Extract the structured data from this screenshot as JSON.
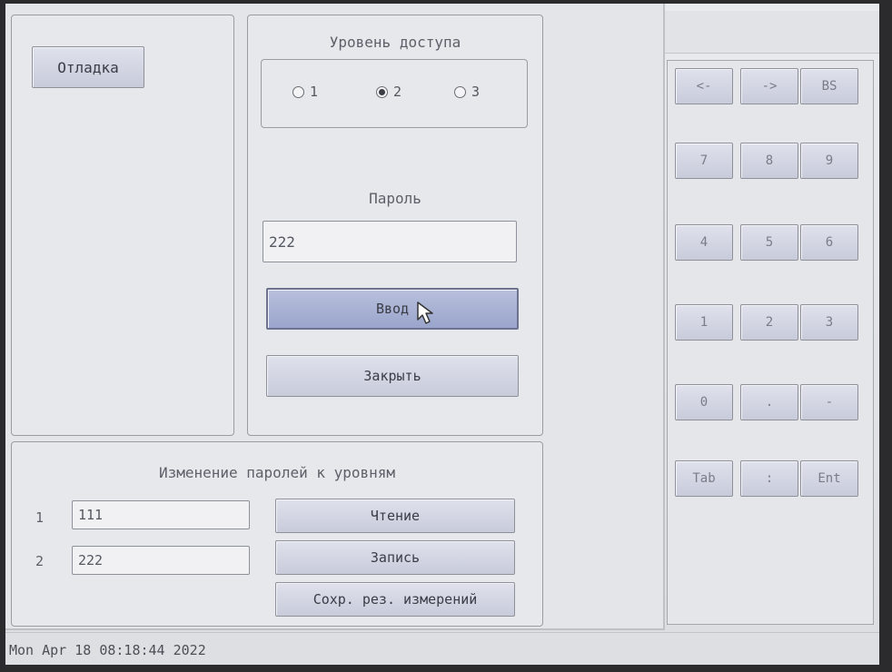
{
  "debug": {
    "button_label": "Отладка"
  },
  "access": {
    "title": "Уровень доступа",
    "options": [
      {
        "label": "1",
        "selected": false
      },
      {
        "label": "2",
        "selected": true
      },
      {
        "label": "3",
        "selected": false
      }
    ]
  },
  "password": {
    "label": "Пароль",
    "value": "222",
    "enter_label": "Ввод",
    "close_label": "Закрыть"
  },
  "change": {
    "title": "Изменение паролей к уровням",
    "rows": [
      {
        "num": "1",
        "value": "111"
      },
      {
        "num": "2",
        "value": "222"
      }
    ],
    "read_label": "Чтение",
    "write_label": "Запись",
    "save_label": "Сохр. рез. измерений"
  },
  "keypad": {
    "rows": [
      [
        "<-",
        "->",
        "BS"
      ],
      [
        "7",
        "8",
        "9"
      ],
      [
        "4",
        "5",
        "6"
      ],
      [
        "1",
        "2",
        "3"
      ],
      [
        "0",
        ".",
        "-"
      ],
      [
        "Tab",
        ":",
        "Ent"
      ]
    ]
  },
  "status": {
    "datetime": "Mon Apr 18 08:18:44 2022"
  }
}
